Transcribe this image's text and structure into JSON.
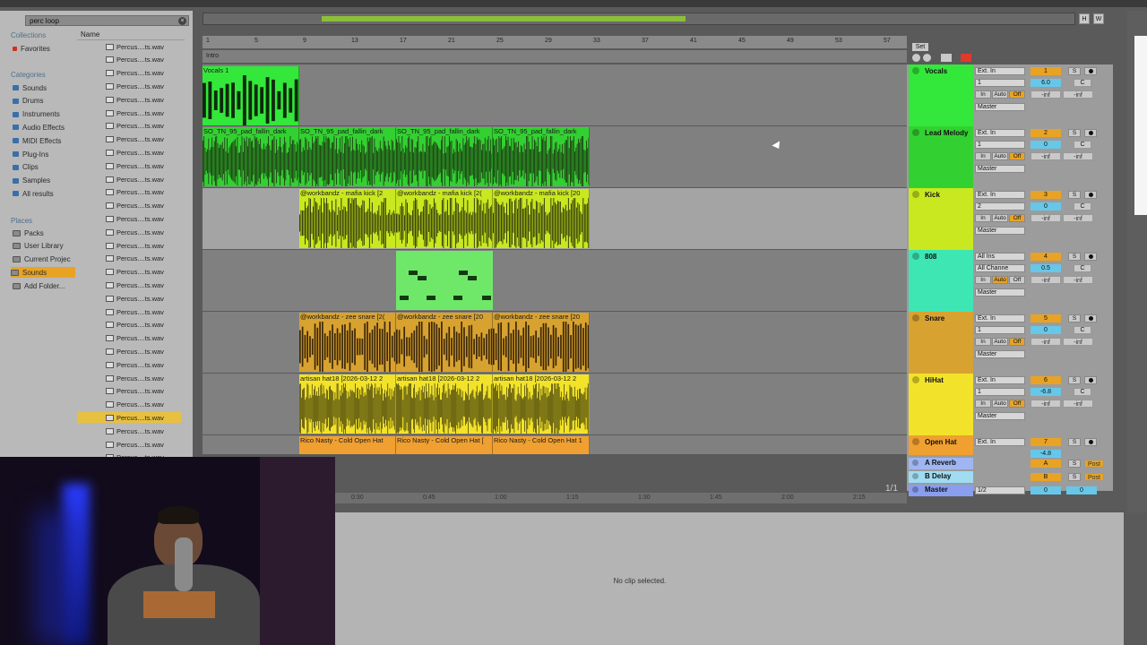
{
  "browser": {
    "search_value": "perc loop",
    "collections_label": "Collections",
    "name_header": "Name",
    "collections": [
      {
        "label": "Favorites",
        "color": "#d03020"
      }
    ],
    "categories_label": "Categories",
    "categories": [
      "Sounds",
      "Drums",
      "Instruments",
      "Audio Effects",
      "MIDI Effects",
      "Plug-Ins",
      "Clips",
      "Samples",
      "All results"
    ],
    "places_label": "Places",
    "places": [
      "Packs",
      "User Library",
      "Current Projec",
      "Sounds",
      "Add Folder..."
    ],
    "selected_place": "Sounds",
    "files": [
      "Percus....ts.wav",
      "Percus....ts.wav",
      "Percus....ts.wav",
      "Percus....ts.wav",
      "Percus....ts.wav",
      "Percus....ts.wav",
      "Percus....ts.wav",
      "Percus....ts.wav",
      "Percus....ts.wav",
      "Percus....ts.wav",
      "Percus....ts.wav",
      "Percus....ts.wav",
      "Percus....ts.wav",
      "Percus....ts.wav",
      "Percus....ts.wav",
      "Percus....ts.wav",
      "Percus....ts.wav",
      "Percus....ts.wav",
      "Percus....ts.wav",
      "Percus....ts.wav",
      "Percus....ts.wav",
      "Percus....ts.wav",
      "Percus....ts.wav",
      "Percus....ts.wav",
      "Percus....ts.wav",
      "Percus....ts.wav",
      "Percus....ts.wav",
      "Percus....ts.wav",
      "Percus....ts.wav",
      "Percus....ts.wav",
      "Percus....ts.wav",
      "Percus....ts.wav"
    ],
    "selected_file_index": 28
  },
  "arrangement": {
    "ruler_ticks": [
      "1",
      "5",
      "9",
      "13",
      "17",
      "21",
      "25",
      "29",
      "33",
      "37",
      "41",
      "45",
      "49",
      "53",
      "57"
    ],
    "locator": "Intro",
    "set_label": "Set",
    "time_ticks": [
      "0:30",
      "0:45",
      "1:00",
      "1:15",
      "1:30",
      "1:45",
      "2:00",
      "2:15"
    ],
    "zoom_readout": "1/1"
  },
  "tracks": [
    {
      "name": "Vocals",
      "color": "#33e83a",
      "input": "Ext. In",
      "channel": "1",
      "monitor": "Off",
      "output": "Master",
      "number": "1",
      "volume": "6.0",
      "pan": "C",
      "send_a": "-inf",
      "send_b": "-inf"
    },
    {
      "name": "Lead Melody",
      "color": "#33d032",
      "input": "Ext. In",
      "channel": "1",
      "monitor": "Off",
      "output": "Master",
      "number": "2",
      "volume": "0",
      "pan": "C",
      "send_a": "-inf",
      "send_b": "-inf"
    },
    {
      "name": "Kick",
      "color": "#c9e820",
      "input": "Ext. In",
      "channel": "2",
      "monitor": "Off",
      "output": "Master",
      "number": "3",
      "volume": "0",
      "pan": "C",
      "send_a": "-inf",
      "send_b": "-inf"
    },
    {
      "name": "808",
      "color": "#3ee6b4",
      "input": "All Ins",
      "channel": "All Channe",
      "monitor": "Auto",
      "output": "Master",
      "number": "4",
      "volume": "0.5",
      "pan": "C",
      "send_a": "-inf",
      "send_b": "-inf"
    },
    {
      "name": "Snare",
      "color": "#d8a230",
      "input": "Ext. In",
      "channel": "1",
      "monitor": "Off",
      "output": "Master",
      "number": "5",
      "volume": "0",
      "pan": "C",
      "send_a": "-inf",
      "send_b": "-inf"
    },
    {
      "name": "HiHat",
      "color": "#f2e32a",
      "input": "Ext. In",
      "channel": "1",
      "monitor": "Off",
      "output": "Master",
      "number": "6",
      "volume": "-6.8",
      "pan": "C",
      "send_a": "-inf",
      "send_b": "-inf"
    },
    {
      "name": "Open Hat",
      "color": "#f0a030",
      "input": "Ext. In",
      "channel": "1",
      "number": "7",
      "volume": "-4.8"
    }
  ],
  "returns": [
    {
      "name": "A Reverb",
      "color": "#9fb6f2",
      "letter": "A",
      "post": "Post"
    },
    {
      "name": "B Delay",
      "color": "#9fdcf2",
      "letter": "B",
      "post": "Post"
    },
    {
      "name": "Master",
      "color": "#8a9ef0",
      "output": "1/2",
      "volume": "0",
      "pan": "0"
    }
  ],
  "clips": {
    "vocals": "Vocals 1",
    "pad": [
      "SO_TN_95_pad_fallin_dark",
      "SO_TN_95_pad_fallin_dark",
      "SO_TN_95_pad_fallin_dark",
      "SO_TN_95_pad_fallin_dark"
    ],
    "kick": [
      "@workbandz - mafia kick [2",
      "@workbandz - mafia kick [2(",
      "@workbandz - mafia kick [20"
    ],
    "snare": [
      "@workbandz - zee snare [2(",
      "@workbandz - zee snare [20",
      "@workbandz - zee snare [20"
    ],
    "hat": [
      "artisan hat18 [2026-03-12 2",
      "artisan hat18 [2026-03-12 2",
      "artisan hat18 [2026-03-12 2"
    ],
    "openhat": [
      "Rico Nasty - Cold Open Hat",
      "Rico Nasty - Cold Open Hat [",
      "Rico Nasty - Cold Open Hat 1"
    ]
  },
  "detail": {
    "message": "No clip selected."
  },
  "colors": {
    "accent": "#e8a325",
    "clip_green": "#33e83a",
    "clip_yellow": "#c9e820",
    "clip_orange": "#d8a230"
  }
}
